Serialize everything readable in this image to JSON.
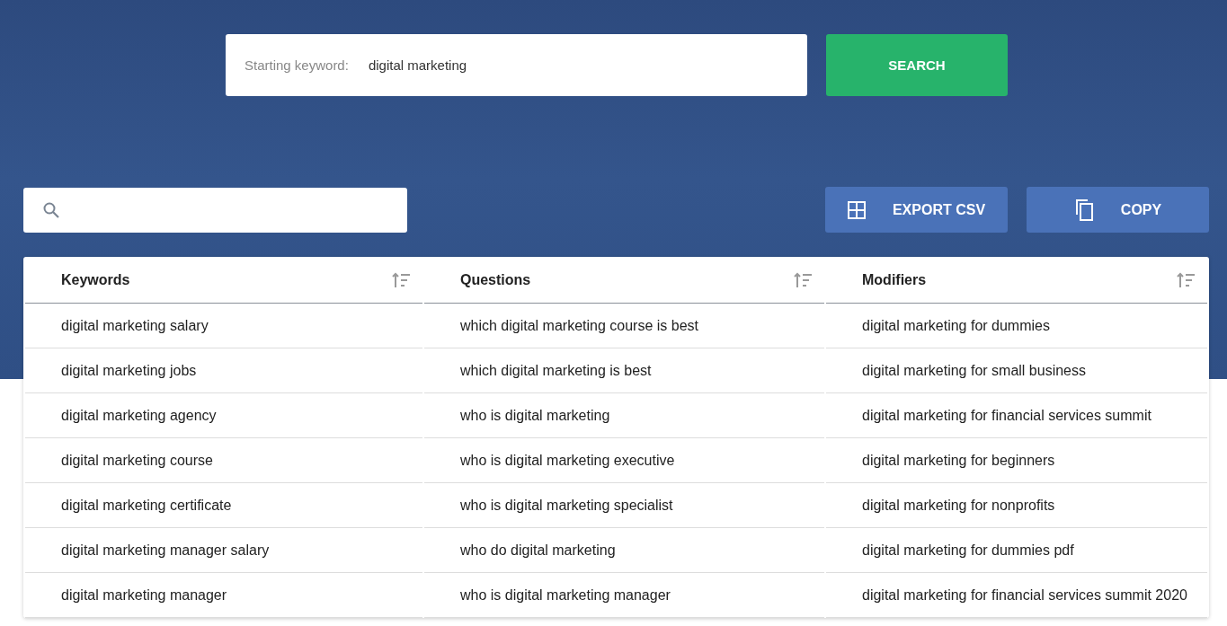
{
  "keyword_search": {
    "label": "Starting keyword:",
    "value": "digital marketing",
    "button": "SEARCH"
  },
  "actions": [
    {
      "kind": "export",
      "label": "EXPORT CSV"
    },
    {
      "kind": "copy",
      "label": "COPY"
    }
  ],
  "table": {
    "columns": [
      "Keywords",
      "Questions",
      "Modifiers"
    ],
    "rows": [
      [
        "digital marketing salary",
        "which digital marketing course is best",
        "digital marketing for dummies"
      ],
      [
        "digital marketing jobs",
        "which digital marketing is best",
        "digital marketing for small business"
      ],
      [
        "digital marketing agency",
        "who is digital marketing",
        "digital marketing for financial services summit"
      ],
      [
        "digital marketing course",
        "who is digital marketing executive",
        "digital marketing for beginners"
      ],
      [
        "digital marketing certificate",
        "who is digital marketing specialist",
        "digital marketing for nonprofits"
      ],
      [
        "digital marketing manager salary",
        "who do digital marketing",
        "digital marketing for dummies pdf"
      ],
      [
        "digital marketing manager",
        "who is digital marketing manager",
        "digital marketing for financial services summit 2020"
      ]
    ]
  }
}
